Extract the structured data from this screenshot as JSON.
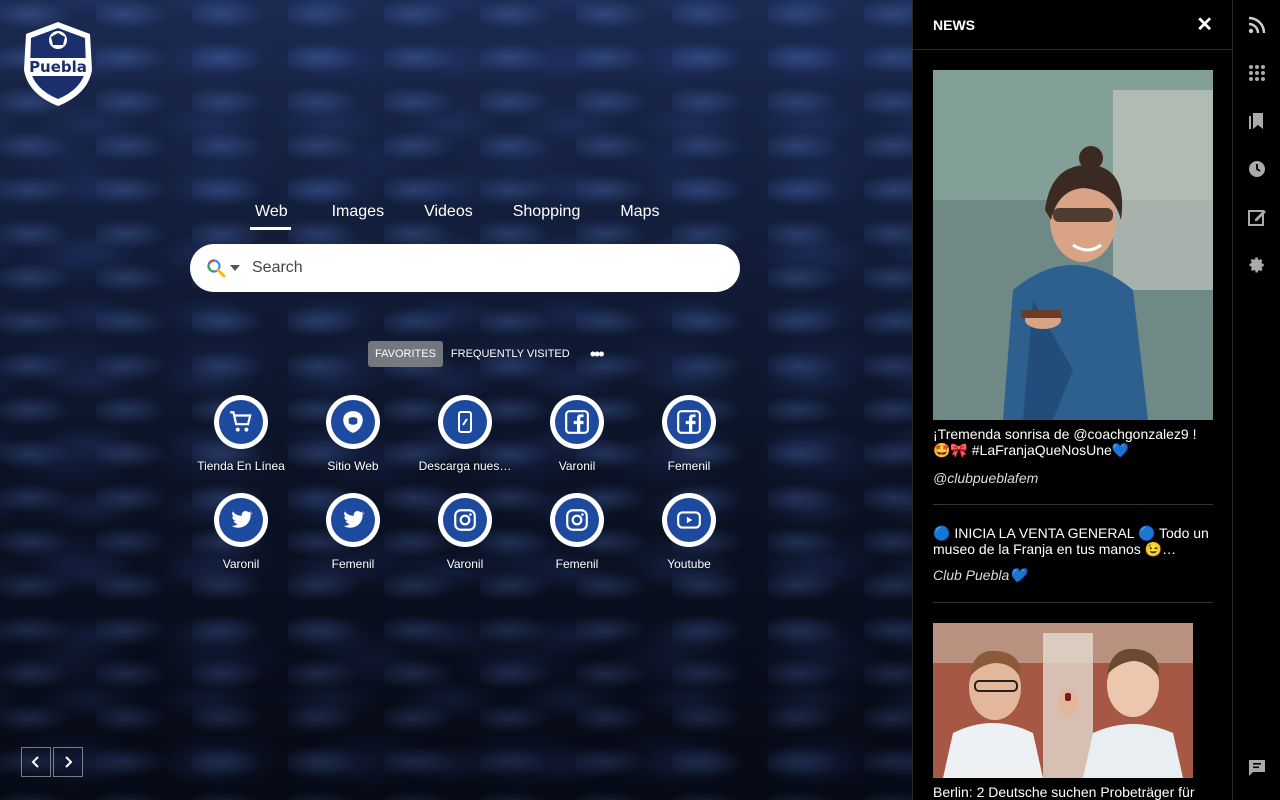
{
  "logo": {
    "text": "Puebla"
  },
  "search": {
    "tabs": [
      "Web",
      "Images",
      "Videos",
      "Shopping",
      "Maps"
    ],
    "active_tab": "Web",
    "placeholder": "Search"
  },
  "favorites": {
    "tabs": [
      "FAVORITES",
      "FREQUENTLY VISITED"
    ],
    "active_tab": "FAVORITES",
    "more_icon": "more-dots-icon"
  },
  "tiles": [
    {
      "label": "Tienda En Línea",
      "icon": "cart-icon"
    },
    {
      "label": "Sitio Web",
      "icon": "club-crest-icon"
    },
    {
      "label": "Descarga nues…",
      "icon": "phone-icon"
    },
    {
      "label": "Varonil",
      "icon": "facebook-icon"
    },
    {
      "label": "Femenil",
      "icon": "facebook-icon"
    },
    {
      "label": "Varonil",
      "icon": "twitter-icon"
    },
    {
      "label": "Femenil",
      "icon": "twitter-icon"
    },
    {
      "label": "Varonil",
      "icon": "instagram-icon"
    },
    {
      "label": "Femenil",
      "icon": "instagram-icon"
    },
    {
      "label": "Youtube",
      "icon": "youtube-icon"
    }
  ],
  "pager": {
    "prev": "‹",
    "next": "›"
  },
  "news": {
    "title": "NEWS",
    "close": "✕",
    "articles": [
      {
        "text": "¡Tremenda sonrisa de @coachgonzalez9 !🤩🎀 #LaFranjaQueNosUne💙",
        "source": "@clubpueblafem"
      },
      {
        "text": "🔵 INICIA LA VENTA GENERAL 🔵 Todo un museo de la Franja en tus manos 😉…",
        "source": "Club Puebla💙"
      },
      {
        "text": "Berlin: 2 Deutsche suchen Probeträger für",
        "source": ""
      }
    ]
  },
  "rail": [
    "rss-icon",
    "apps-grid-icon",
    "bookmarks-icon",
    "history-icon",
    "notes-icon",
    "settings-icon",
    "feedback-icon"
  ],
  "colors": {
    "tile_inner": "#1d4a9e",
    "panel_bg": "#000000"
  }
}
